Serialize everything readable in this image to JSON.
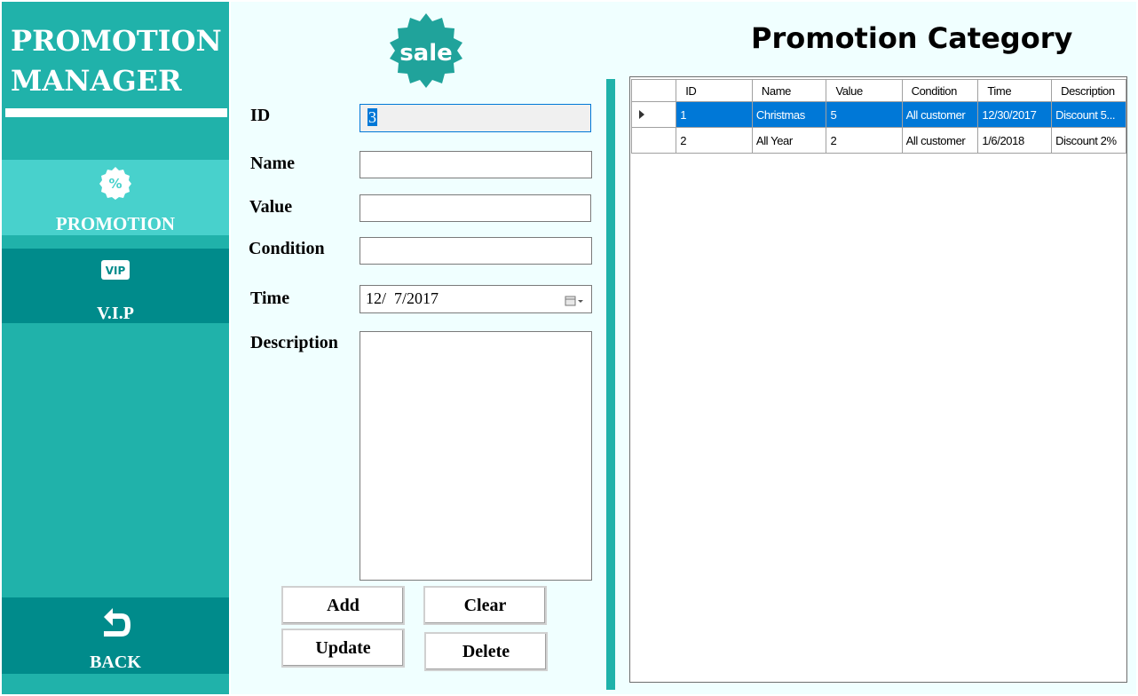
{
  "sidebar": {
    "title_line1": "PROMOTION",
    "title_line2": "MANAGER",
    "items": [
      {
        "label": "PROMOTION",
        "icon": "percent-badge-icon"
      },
      {
        "label": "V.I.P",
        "icon": "vip-icon"
      }
    ],
    "back_label": "BACK",
    "colors": {
      "sidebar": "#20b2aa",
      "active": "#48d1cc",
      "dark": "#008b8b"
    }
  },
  "badge": {
    "text": "sale",
    "color": "#20a39b"
  },
  "form": {
    "id_label": "ID",
    "id_value": "3",
    "name_label": "Name",
    "name_value": "",
    "value_label": "Value",
    "value_value": "",
    "condition_label": "Condition",
    "condition_value": "",
    "time_label": "Time",
    "time_value": "12/  7/2017",
    "description_label": "Description",
    "description_value": ""
  },
  "buttons": {
    "add": "Add",
    "clear": "Clear",
    "update": "Update",
    "delete": "Delete"
  },
  "grid": {
    "title": "Promotion Category",
    "columns": [
      "ID",
      "Name",
      "Value",
      "Condition",
      "Time",
      "Description"
    ],
    "rows": [
      {
        "id": "1",
        "name": "Christmas",
        "value": "5",
        "condition": "All customer",
        "time": "12/30/2017",
        "description": "Discount 5..."
      },
      {
        "id": "2",
        "name": "All Year",
        "value": "2",
        "condition": "All customer",
        "time": "1/6/2018",
        "description": "Discount 2%"
      }
    ],
    "selected_row": 0
  }
}
